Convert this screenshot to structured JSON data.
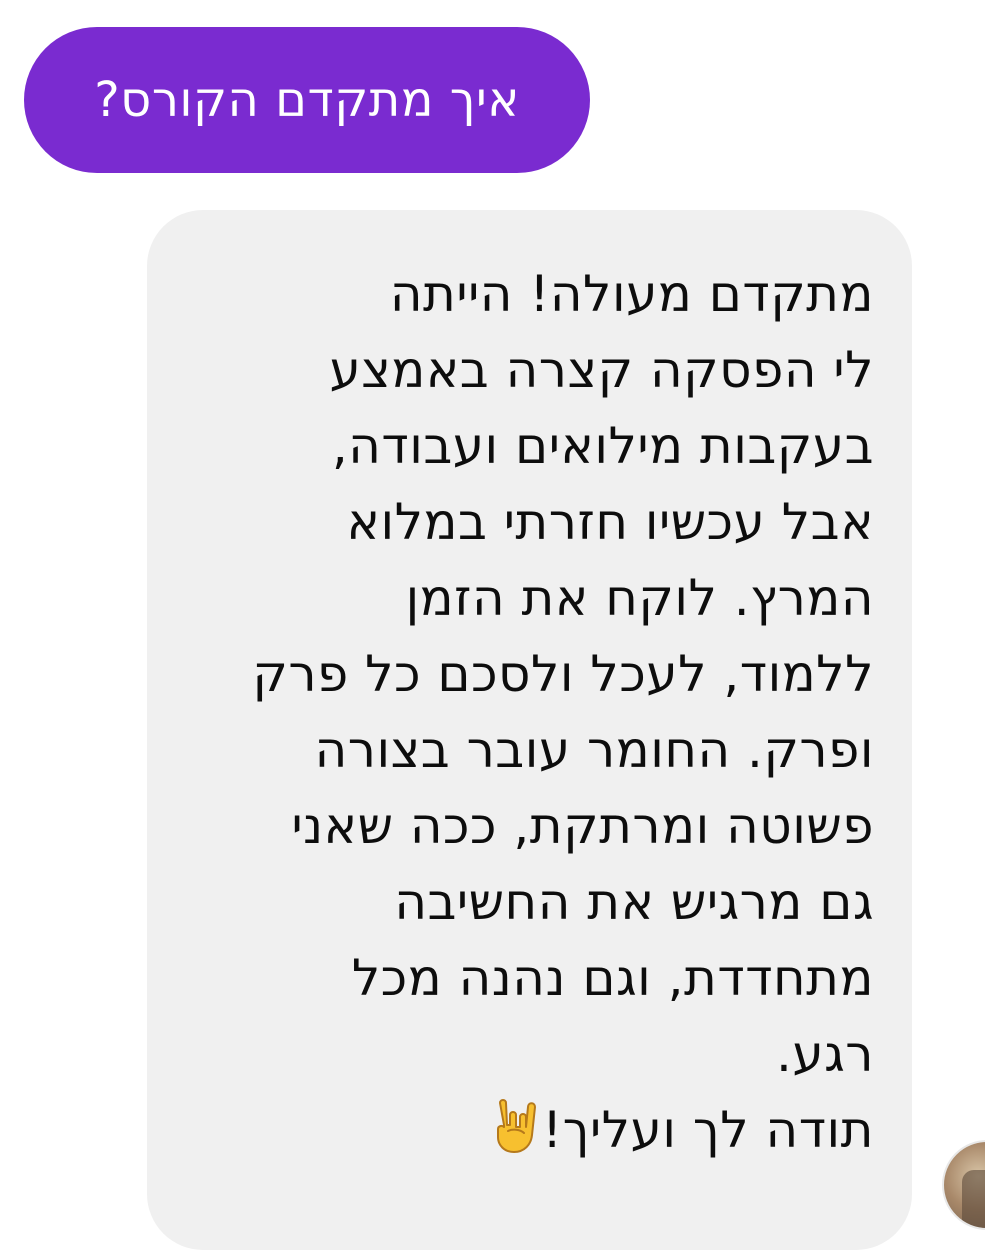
{
  "conversation": {
    "outgoing": {
      "text": "איך מתקדם הקורס?",
      "color": "#7a2bd0"
    },
    "incoming": {
      "lines": [
        "מתקדם מעולה! הייתה",
        "לי הפסקה קצרה באמצע",
        "בעקבות מילואים ועבודה,",
        "אבל עכשיו חזרתי במלוא",
        "המרץ. לוקח את הזמן",
        "ללמוד, לעכל ולסכם כל פרק",
        "ופרק. החומר עובר בצורה",
        "פשוטה ומרתקת, ככה שאני",
        "גם מרגיש את החשיבה",
        "מתחדדת, וגם נהנה מכל",
        "רגע.",
        "תודה לך ועליך!"
      ],
      "emoji": "sign-of-the-horns-emoji",
      "color": "#f0f0f0"
    },
    "sender_avatar": "avatar"
  }
}
